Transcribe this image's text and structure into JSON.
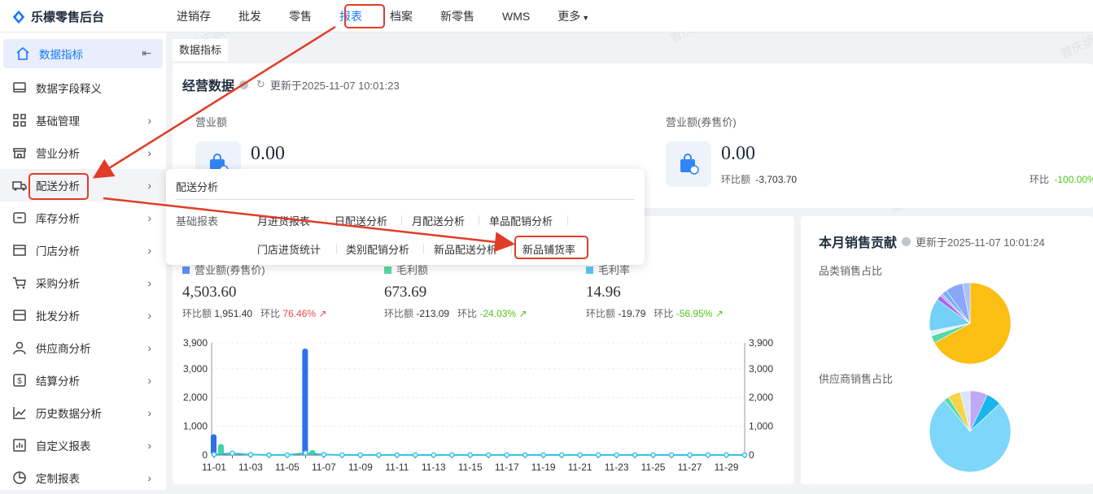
{
  "app": {
    "title": "乐檬零售后台"
  },
  "nav": [
    "进销存",
    "批发",
    "零售",
    "报表",
    "档案",
    "新零售",
    "WMS",
    "更多"
  ],
  "sidebar": {
    "items": [
      "数据指标",
      "数据字段释义",
      "基础管理",
      "营业分析",
      "配送分析",
      "库存分析",
      "门店分析",
      "采购分析",
      "批发分析",
      "供应商分析",
      "结算分析",
      "历史数据分析",
      "自定义报表",
      "定制报表"
    ]
  },
  "tab": "数据指标",
  "business": {
    "title": "经营数据",
    "updated": "更新于2025-11-07 10:01:23",
    "revenue_label": "营业额",
    "revenue_value": "0.00",
    "coupon_label": "营业额(券售价)",
    "coupon_value": "0.00",
    "coupon_cmp_label": "环比额",
    "coupon_cmp_value": "-3,703.70",
    "ratio_label": "环比",
    "ratio_value": "-100.00%"
  },
  "dropdown": {
    "title": "配送分析",
    "sub": "基础报表",
    "links_row1": [
      "月进货报表",
      "日配送分析",
      "月配送分析",
      "单品配销分析"
    ],
    "links_row2": [
      "门店进货统计",
      "类别配销分析",
      "新品配送分析",
      "新品铺货率"
    ]
  },
  "metrics": [
    {
      "label": "营业额(券售价)",
      "value": "4,503.60",
      "cmp_label": "环比额",
      "cmp": "1,951.40",
      "ratio_label": "环比",
      "ratio": "76.46%",
      "color": "#5b8ff9",
      "ratio_color": "#e84848"
    },
    {
      "label": "毛利额",
      "value": "673.69",
      "cmp_label": "环比额",
      "cmp": "-213.09",
      "ratio_label": "环比",
      "ratio": "-24.03%",
      "color": "#5ad8a6",
      "ratio_color": "#52c41a"
    },
    {
      "label": "毛利率",
      "value": "14.96",
      "cmp_label": "环比额",
      "cmp": "-19.79",
      "ratio_label": "环比",
      "ratio": "-56.95%",
      "color": "#5bc6f0",
      "ratio_color": "#52c41a"
    }
  ],
  "chart_data": {
    "type": "bar",
    "categories": [
      "11-01",
      "11-02",
      "11-03",
      "11-04",
      "11-05",
      "11-06",
      "11-07",
      "11-08",
      "11-09",
      "11-10",
      "11-11",
      "11-12",
      "11-13",
      "11-14",
      "11-15",
      "11-16",
      "11-17",
      "11-18",
      "11-19",
      "11-20",
      "11-21",
      "11-22",
      "11-23",
      "11-24",
      "11-25",
      "11-26",
      "11-27",
      "11-28",
      "11-29",
      "11-30"
    ],
    "tick_labels": [
      "11-01",
      "11-03",
      "11-05",
      "11-07",
      "11-09",
      "11-11",
      "11-13",
      "11-15",
      "11-17",
      "11-19",
      "11-21",
      "11-23",
      "11-25",
      "11-27",
      "11-29"
    ],
    "y_ticks": [
      "3,900",
      "3,000",
      "2,000",
      "1,000",
      "0"
    ],
    "ylim": [
      0,
      3900
    ],
    "series": [
      {
        "name": "营业额(券售价)",
        "type": "bar",
        "color": "#2f6fea",
        "values": [
          720,
          0,
          0,
          0,
          0,
          3700,
          0,
          0,
          0,
          0,
          0,
          0,
          0,
          0,
          0,
          0,
          0,
          0,
          0,
          0,
          0,
          0,
          0,
          0,
          0,
          0,
          0,
          0,
          0,
          0
        ]
      },
      {
        "name": "毛利额",
        "type": "bar",
        "color": "#3ed6a0",
        "values": [
          380,
          0,
          0,
          0,
          0,
          170,
          0,
          0,
          0,
          0,
          0,
          0,
          0,
          0,
          0,
          0,
          0,
          0,
          0,
          0,
          0,
          0,
          0,
          0,
          0,
          0,
          0,
          0,
          0,
          0
        ]
      },
      {
        "name": "毛利率",
        "type": "line",
        "color": "#35c3e8",
        "values": [
          20,
          60,
          15,
          0,
          0,
          70,
          15,
          0,
          0,
          0,
          0,
          0,
          0,
          0,
          0,
          0,
          0,
          0,
          0,
          0,
          0,
          0,
          0,
          0,
          0,
          0,
          0,
          0,
          0,
          0
        ]
      }
    ]
  },
  "contrib": {
    "title": "本月销售贡献",
    "updated": "更新于2025-11-07 10:01:24",
    "cat_label": "品类销售占比",
    "sup_label": "供应商销售占比"
  },
  "pie_category": [
    {
      "value": 67,
      "color": "#fbbf14"
    },
    {
      "value": 3,
      "color": "#5ad8a6"
    },
    {
      "value": 2,
      "color": "#e0f2fb"
    },
    {
      "value": 13,
      "color": "#72d1f5"
    },
    {
      "value": 2,
      "color": "#9b6cf0"
    },
    {
      "value": 1,
      "color": "#c79ff7"
    },
    {
      "value": 2,
      "color": "#6fb3f5"
    },
    {
      "value": 7,
      "color": "#8aa6f8"
    },
    {
      "value": 3,
      "color": "#a9c0fb"
    }
  ],
  "pie_supplier": [
    {
      "value": 7,
      "color": "#bfa8f5"
    },
    {
      "value": 6,
      "color": "#1ab5ea"
    },
    {
      "value": 76,
      "color": "#7ed6fa"
    },
    {
      "value": 2,
      "color": "#5ad8a6"
    },
    {
      "value": 5,
      "color": "#f7d24a"
    },
    {
      "value": 4,
      "color": "#d7e6fa"
    }
  ],
  "watermark": "曾庆娟0829"
}
